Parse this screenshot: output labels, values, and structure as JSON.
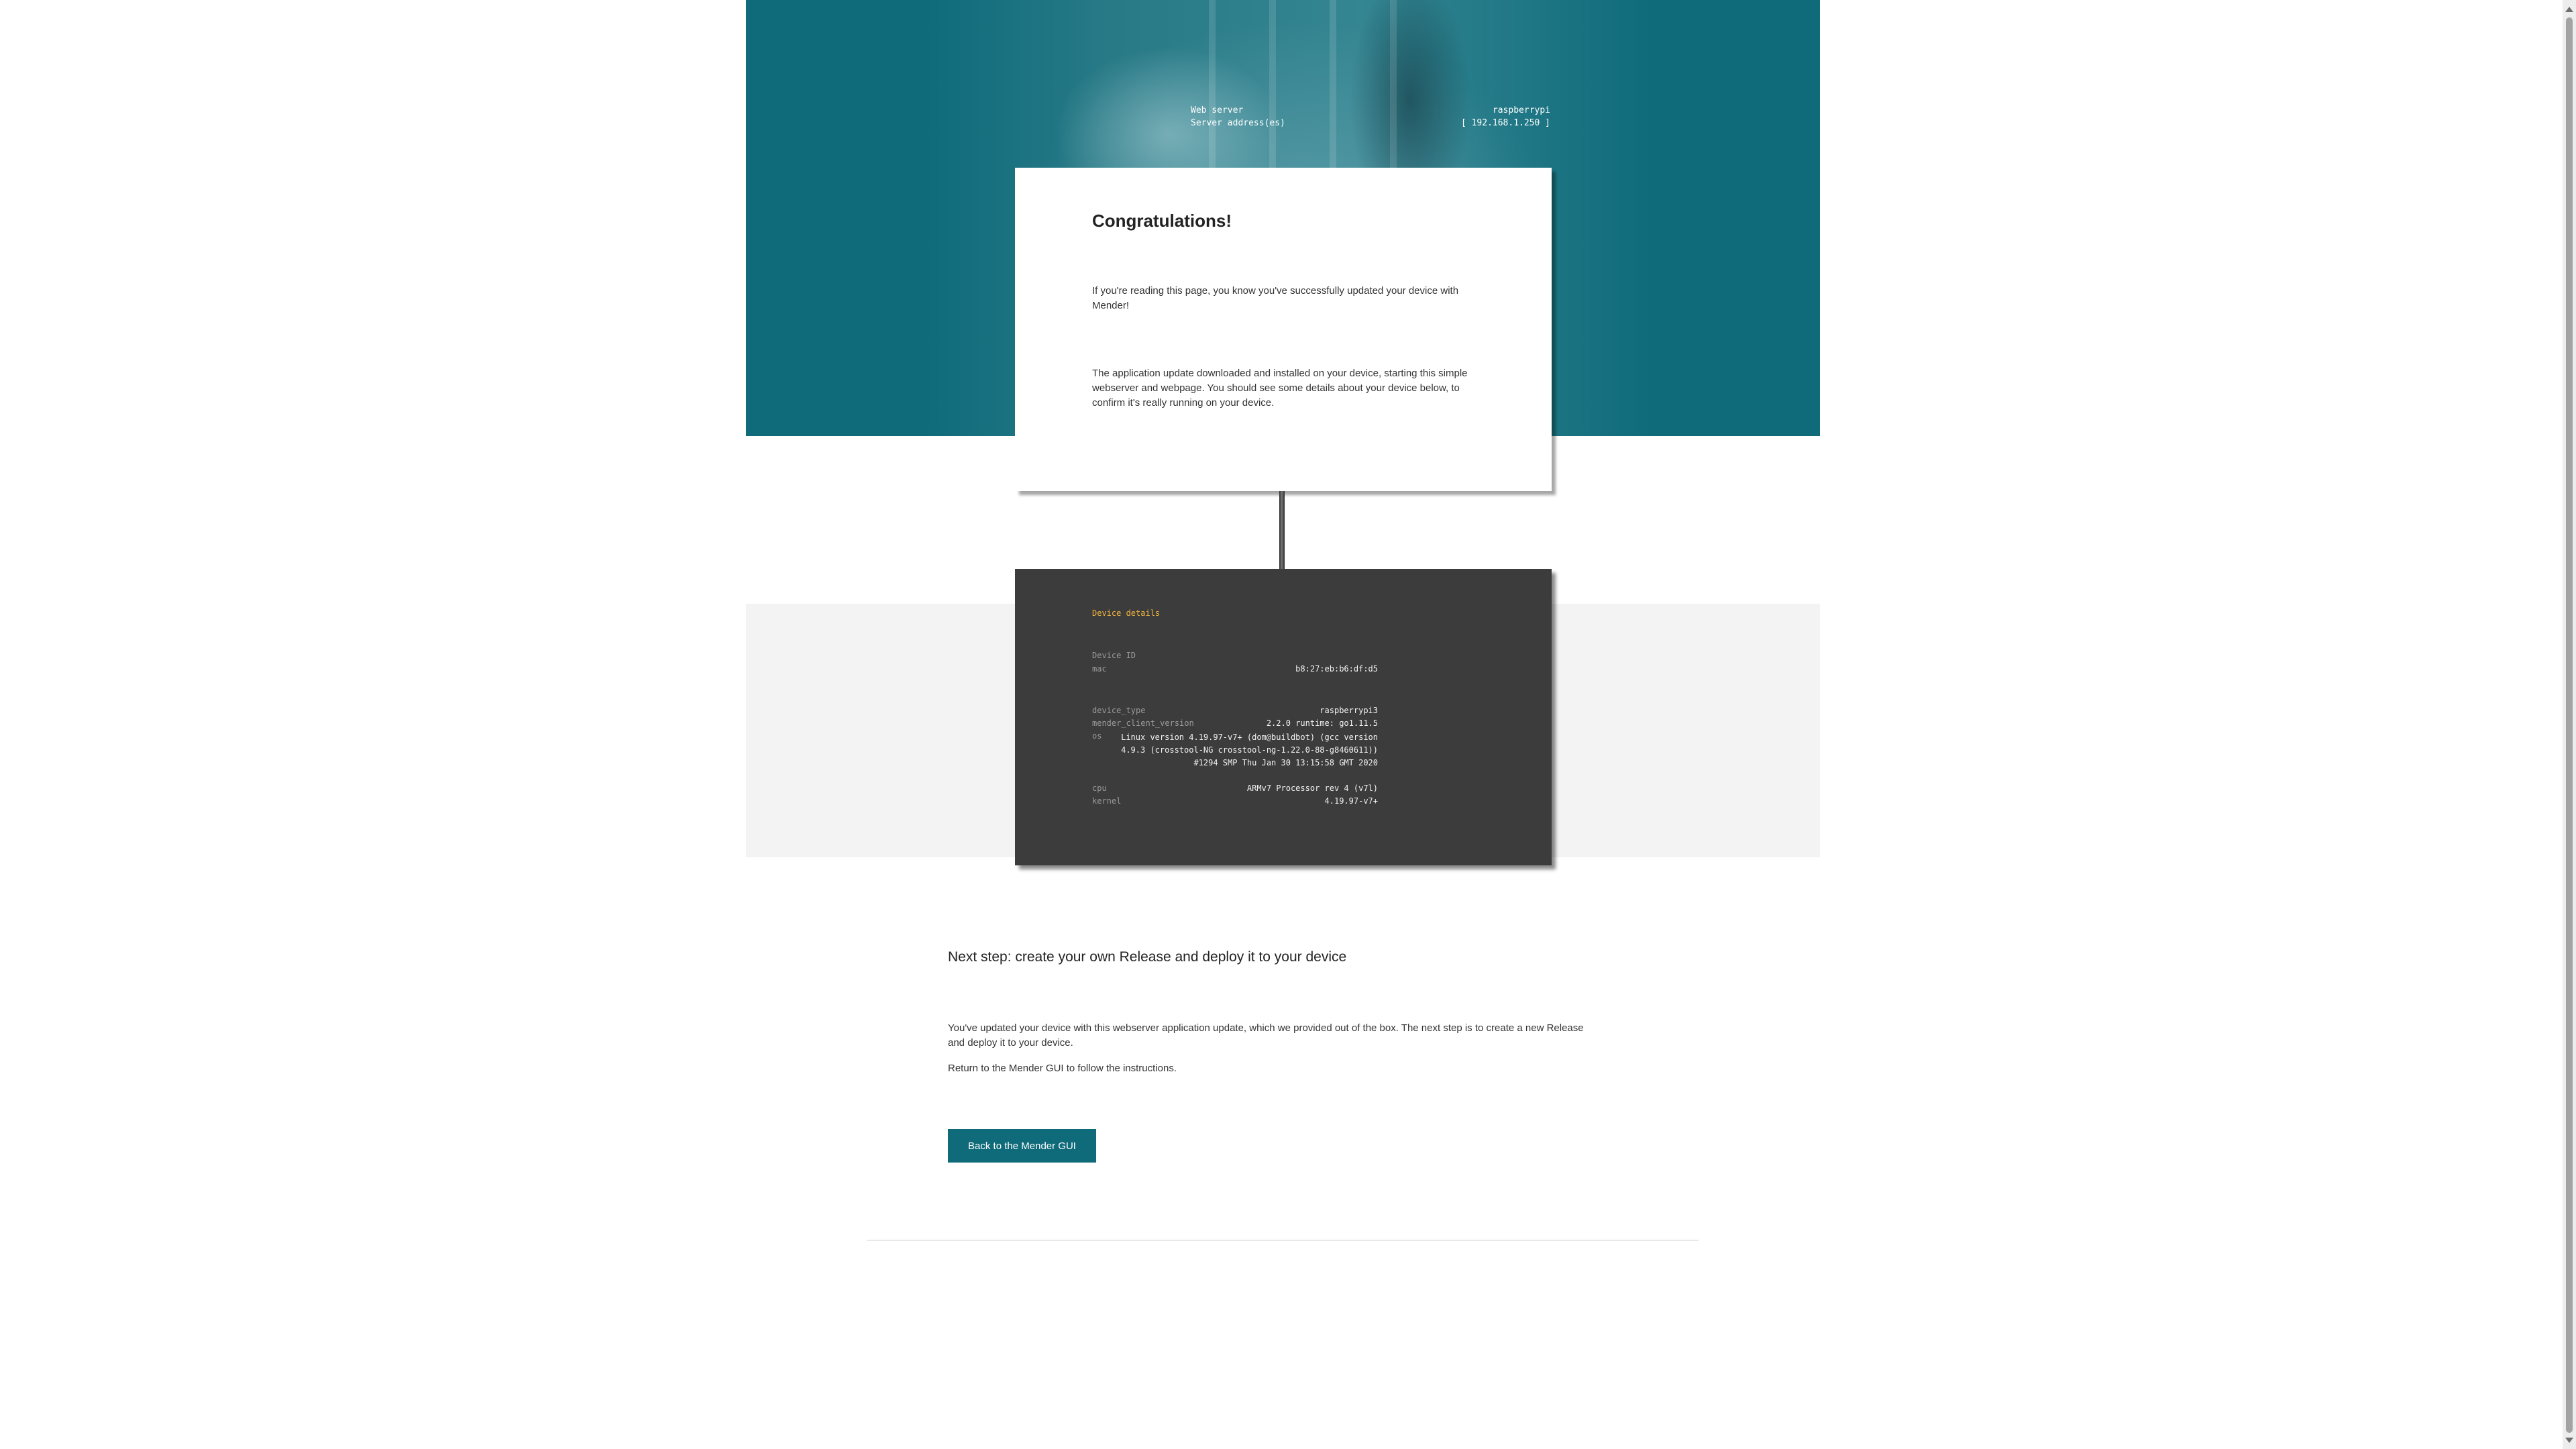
{
  "colors": {
    "brand_teal": "#0f6b7a",
    "terminal_bg": "#3c3c3c",
    "terminal_heading": "#f0b43c",
    "band_grey": "#f3f3f3"
  },
  "hero": {
    "web_server_label": "Web server",
    "web_server_value": "raspberrypi",
    "server_address_label": "Server address(es)",
    "server_address_value": "[ 192.168.1.250 ]"
  },
  "congrats": {
    "title": "Congratulations!",
    "p1": "If you're reading this page, you know you've successfully updated your device with Mender!",
    "p2": "The application update downloaded and installed on your device, starting this simple webserver and webpage. You should see some details about your device below, to confirm it's really running on your device."
  },
  "device": {
    "title": "Device details",
    "device_id_label": "Device ID",
    "mac_key": "mac",
    "mac_value": "b8:27:eb:b6:df:d5",
    "device_type_key": "device_type",
    "device_type_value": "raspberrypi3",
    "client_version_key": "mender_client_version",
    "client_version_value": "2.2.0 runtime: go1.11.5",
    "os_key": "os",
    "os_value": "Linux version 4.19.97-v7+ (dom@buildbot) (gcc version 4.9.3 (crosstool-NG crosstool-ng-1.22.0-88-g8460611)) #1294 SMP Thu Jan 30 13:15:58 GMT 2020",
    "cpu_key": "cpu",
    "cpu_value": "ARMv7 Processor rev 4 (v7l)",
    "kernel_key": "kernel",
    "kernel_value": "4.19.97-v7+"
  },
  "next": {
    "title": "Next step: create your own Release and deploy it to your device",
    "p1": "You've updated your device with this webserver application update, which we provided out of the box. The next step is to create a new Release and deploy it to your device.",
    "p2": "Return to the Mender GUI to follow the instructions.",
    "button_label": "Back to the Mender GUI"
  }
}
